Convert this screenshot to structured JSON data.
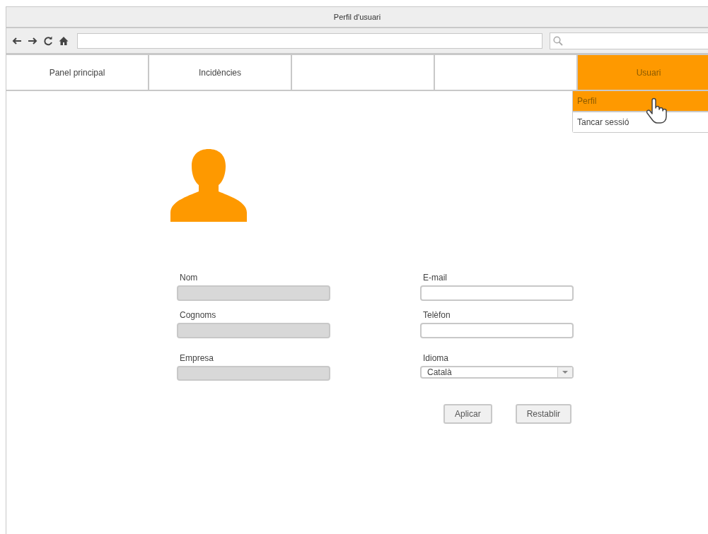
{
  "window": {
    "title": "Perfil d'usuari"
  },
  "nav_tabs": [
    {
      "label": "Panel principal",
      "selected": false
    },
    {
      "label": "Incidències",
      "selected": false
    },
    {
      "selected": false
    },
    {
      "selected": false
    },
    {
      "label": "Usuari",
      "selected": true
    }
  ],
  "user_menu": [
    {
      "label": "Perfil",
      "selected": true
    },
    {
      "label": "Tancar sessió",
      "selected": false
    }
  ],
  "form": {
    "left": [
      {
        "label": "Nom",
        "disabled": true,
        "kind": "text"
      },
      {
        "label": "Cognoms",
        "disabled": true,
        "kind": "text"
      },
      {
        "label": "Empresa",
        "disabled": true,
        "kind": "text"
      }
    ],
    "right": [
      {
        "label": "E-mail",
        "disabled": false,
        "kind": "text"
      },
      {
        "label": "Telèfon",
        "disabled": false,
        "kind": "text"
      },
      {
        "label": "Idioma",
        "disabled": false,
        "kind": "select",
        "value": "Català"
      }
    ]
  },
  "buttons": [
    "Aplicar",
    "Restablir"
  ]
}
